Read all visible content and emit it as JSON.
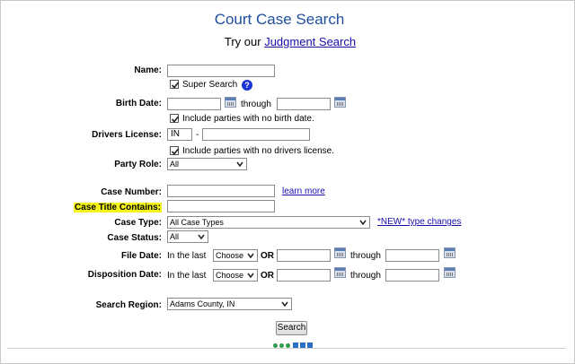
{
  "header": {
    "title": "Court Case Search",
    "subtitle_prefix": "Try our",
    "subtitle_link": "Judgment Search"
  },
  "fields": {
    "name": {
      "label": "Name:",
      "value": ""
    },
    "super_search": {
      "label": "Super Search",
      "checked": true,
      "help": "?"
    },
    "birth_date": {
      "label": "Birth Date:",
      "from": "",
      "through_label": "through",
      "to": ""
    },
    "no_birth": {
      "label": "Include parties with no birth date.",
      "checked": true
    },
    "drivers_license": {
      "label": "Drivers License:",
      "state": "IN",
      "dash": "-",
      "number": ""
    },
    "no_dl": {
      "label": "Include parties with no drivers license.",
      "checked": true
    },
    "party_role": {
      "label": "Party Role:",
      "value": "All"
    },
    "case_number": {
      "label": "Case Number:",
      "value": "",
      "learn_more": "learn more"
    },
    "case_title": {
      "label": "Case Title Contains:",
      "value": ""
    },
    "case_type": {
      "label": "Case Type:",
      "value": "All Case Types",
      "new_link": "*NEW* type changes"
    },
    "case_status": {
      "label": "Case Status:",
      "value": "All"
    },
    "file_date": {
      "label": "File Date:",
      "in_last": "In the last",
      "choose": "Choose",
      "or": "OR",
      "from": "",
      "through_label": "through",
      "to": ""
    },
    "disposition_date": {
      "label": "Disposition Date:",
      "in_last": "In the last",
      "choose": "Choose",
      "or": "OR",
      "from": "",
      "through_label": "through",
      "to": ""
    },
    "search_region": {
      "label": "Search Region:",
      "value": "Adams County, IN"
    }
  },
  "search_button": "Search",
  "colors": {
    "title": "#1f4e9c",
    "highlight": "#f5f51a",
    "link": "#1a0dab",
    "help_badge": "#1b34d6"
  }
}
